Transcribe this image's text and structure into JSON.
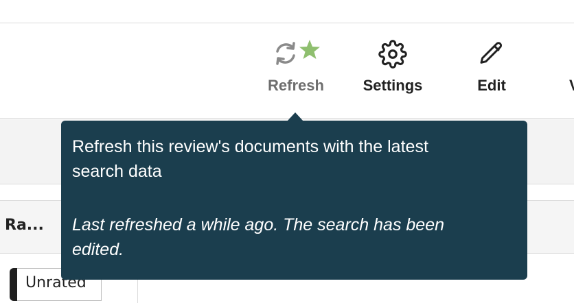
{
  "toolbar": {
    "refresh_label": "Refresh",
    "settings_label": "Settings",
    "edit_label": "Edit",
    "partial_label": "V"
  },
  "tooltip": {
    "description": "Refresh this review's documents with the latest search data",
    "note": "Last refreshed a while ago. The search has been edited."
  },
  "table": {
    "column_header": "Ra...",
    "badge_label": "Unrated"
  },
  "colors": {
    "tooltip_bg": "#1b3e4e",
    "star": "#8fbf6f",
    "refresh_icon": "#8a8a8a",
    "text": "#222222"
  }
}
